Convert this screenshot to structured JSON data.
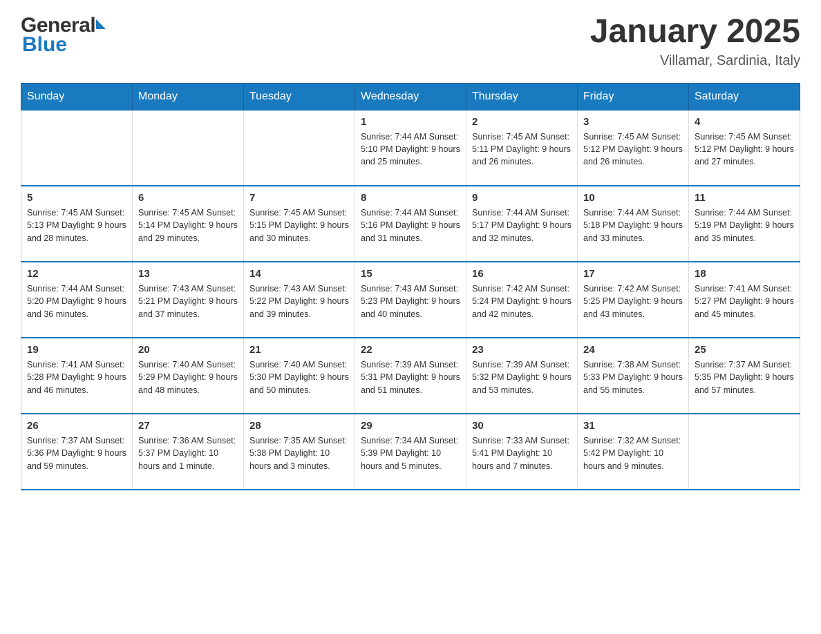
{
  "header": {
    "logo_general": "General",
    "logo_blue": "Blue",
    "month_title": "January 2025",
    "location": "Villamar, Sardinia, Italy"
  },
  "days_of_week": [
    "Sunday",
    "Monday",
    "Tuesday",
    "Wednesday",
    "Thursday",
    "Friday",
    "Saturday"
  ],
  "weeks": [
    [
      {
        "day": "",
        "info": ""
      },
      {
        "day": "",
        "info": ""
      },
      {
        "day": "",
        "info": ""
      },
      {
        "day": "1",
        "info": "Sunrise: 7:44 AM\nSunset: 5:10 PM\nDaylight: 9 hours\nand 25 minutes."
      },
      {
        "day": "2",
        "info": "Sunrise: 7:45 AM\nSunset: 5:11 PM\nDaylight: 9 hours\nand 26 minutes."
      },
      {
        "day": "3",
        "info": "Sunrise: 7:45 AM\nSunset: 5:12 PM\nDaylight: 9 hours\nand 26 minutes."
      },
      {
        "day": "4",
        "info": "Sunrise: 7:45 AM\nSunset: 5:12 PM\nDaylight: 9 hours\nand 27 minutes."
      }
    ],
    [
      {
        "day": "5",
        "info": "Sunrise: 7:45 AM\nSunset: 5:13 PM\nDaylight: 9 hours\nand 28 minutes."
      },
      {
        "day": "6",
        "info": "Sunrise: 7:45 AM\nSunset: 5:14 PM\nDaylight: 9 hours\nand 29 minutes."
      },
      {
        "day": "7",
        "info": "Sunrise: 7:45 AM\nSunset: 5:15 PM\nDaylight: 9 hours\nand 30 minutes."
      },
      {
        "day": "8",
        "info": "Sunrise: 7:44 AM\nSunset: 5:16 PM\nDaylight: 9 hours\nand 31 minutes."
      },
      {
        "day": "9",
        "info": "Sunrise: 7:44 AM\nSunset: 5:17 PM\nDaylight: 9 hours\nand 32 minutes."
      },
      {
        "day": "10",
        "info": "Sunrise: 7:44 AM\nSunset: 5:18 PM\nDaylight: 9 hours\nand 33 minutes."
      },
      {
        "day": "11",
        "info": "Sunrise: 7:44 AM\nSunset: 5:19 PM\nDaylight: 9 hours\nand 35 minutes."
      }
    ],
    [
      {
        "day": "12",
        "info": "Sunrise: 7:44 AM\nSunset: 5:20 PM\nDaylight: 9 hours\nand 36 minutes."
      },
      {
        "day": "13",
        "info": "Sunrise: 7:43 AM\nSunset: 5:21 PM\nDaylight: 9 hours\nand 37 minutes."
      },
      {
        "day": "14",
        "info": "Sunrise: 7:43 AM\nSunset: 5:22 PM\nDaylight: 9 hours\nand 39 minutes."
      },
      {
        "day": "15",
        "info": "Sunrise: 7:43 AM\nSunset: 5:23 PM\nDaylight: 9 hours\nand 40 minutes."
      },
      {
        "day": "16",
        "info": "Sunrise: 7:42 AM\nSunset: 5:24 PM\nDaylight: 9 hours\nand 42 minutes."
      },
      {
        "day": "17",
        "info": "Sunrise: 7:42 AM\nSunset: 5:25 PM\nDaylight: 9 hours\nand 43 minutes."
      },
      {
        "day": "18",
        "info": "Sunrise: 7:41 AM\nSunset: 5:27 PM\nDaylight: 9 hours\nand 45 minutes."
      }
    ],
    [
      {
        "day": "19",
        "info": "Sunrise: 7:41 AM\nSunset: 5:28 PM\nDaylight: 9 hours\nand 46 minutes."
      },
      {
        "day": "20",
        "info": "Sunrise: 7:40 AM\nSunset: 5:29 PM\nDaylight: 9 hours\nand 48 minutes."
      },
      {
        "day": "21",
        "info": "Sunrise: 7:40 AM\nSunset: 5:30 PM\nDaylight: 9 hours\nand 50 minutes."
      },
      {
        "day": "22",
        "info": "Sunrise: 7:39 AM\nSunset: 5:31 PM\nDaylight: 9 hours\nand 51 minutes."
      },
      {
        "day": "23",
        "info": "Sunrise: 7:39 AM\nSunset: 5:32 PM\nDaylight: 9 hours\nand 53 minutes."
      },
      {
        "day": "24",
        "info": "Sunrise: 7:38 AM\nSunset: 5:33 PM\nDaylight: 9 hours\nand 55 minutes."
      },
      {
        "day": "25",
        "info": "Sunrise: 7:37 AM\nSunset: 5:35 PM\nDaylight: 9 hours\nand 57 minutes."
      }
    ],
    [
      {
        "day": "26",
        "info": "Sunrise: 7:37 AM\nSunset: 5:36 PM\nDaylight: 9 hours\nand 59 minutes."
      },
      {
        "day": "27",
        "info": "Sunrise: 7:36 AM\nSunset: 5:37 PM\nDaylight: 10 hours\nand 1 minute."
      },
      {
        "day": "28",
        "info": "Sunrise: 7:35 AM\nSunset: 5:38 PM\nDaylight: 10 hours\nand 3 minutes."
      },
      {
        "day": "29",
        "info": "Sunrise: 7:34 AM\nSunset: 5:39 PM\nDaylight: 10 hours\nand 5 minutes."
      },
      {
        "day": "30",
        "info": "Sunrise: 7:33 AM\nSunset: 5:41 PM\nDaylight: 10 hours\nand 7 minutes."
      },
      {
        "day": "31",
        "info": "Sunrise: 7:32 AM\nSunset: 5:42 PM\nDaylight: 10 hours\nand 9 minutes."
      },
      {
        "day": "",
        "info": ""
      }
    ]
  ],
  "colors": {
    "header_bg": "#1a7abf",
    "header_text": "#ffffff",
    "border": "#1a7abf",
    "title_color": "#333333",
    "location_color": "#555555"
  }
}
